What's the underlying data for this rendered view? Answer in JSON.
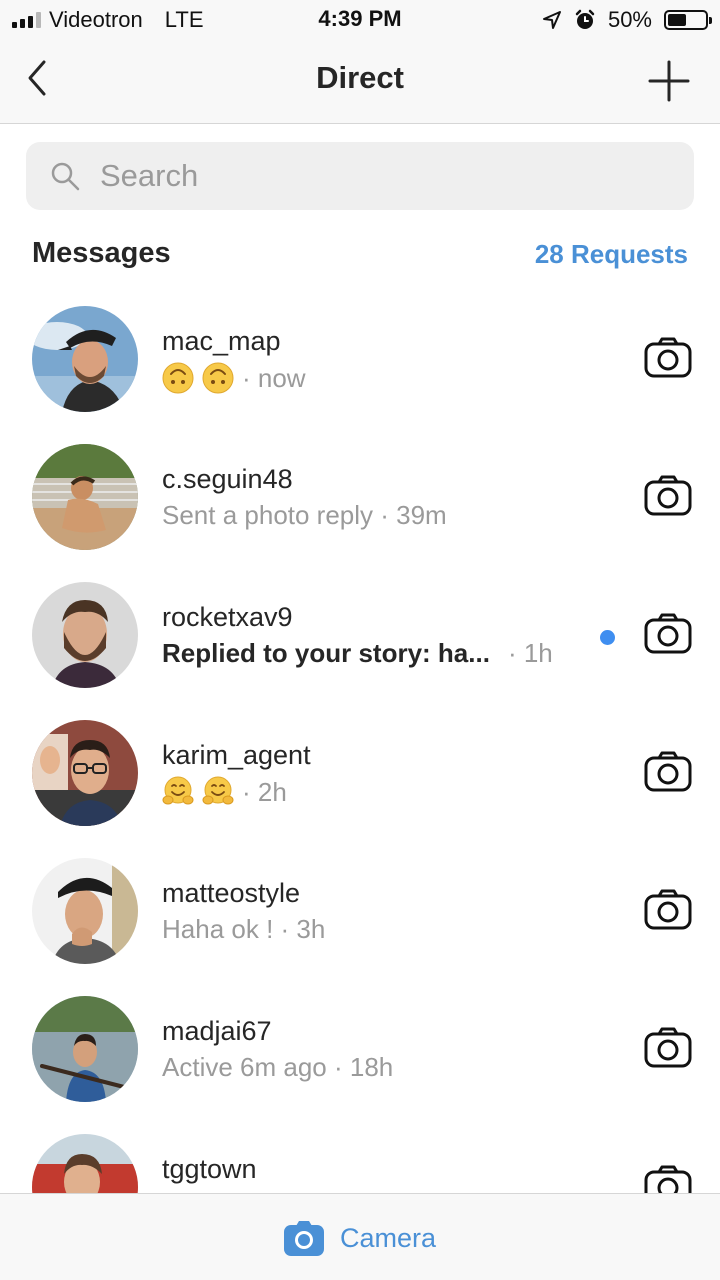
{
  "status_bar": {
    "carrier": "Videotron",
    "network": "LTE",
    "time": "4:39 PM",
    "battery": "50%",
    "battery_level": 0.5,
    "icons": [
      "signal-icon",
      "location-arrow-icon",
      "alarm-icon",
      "battery-icon"
    ]
  },
  "nav": {
    "title": "Direct",
    "back_icon": "chevron-left-icon",
    "add_icon": "plus-icon"
  },
  "search": {
    "placeholder": "Search",
    "icon": "search-icon"
  },
  "section": {
    "title": "Messages",
    "requests_label": "28 Requests"
  },
  "threads": [
    {
      "username": "mac_map",
      "emoji": [
        "upside-down-face",
        "upside-down-face"
      ],
      "time": "· now",
      "unread": false
    },
    {
      "username": "c.seguin48",
      "preview": "Sent a photo reply · 39m",
      "unread": false
    },
    {
      "username": "rocketxav9",
      "preview": "Replied to your story: ha...",
      "time": "· 1h",
      "unread": true
    },
    {
      "username": "karim_agent",
      "emoji": [
        "hugging-face",
        "hugging-face"
      ],
      "time": "· 2h",
      "unread": false
    },
    {
      "username": "matteostyle",
      "preview": "Haha ok ! · 3h",
      "unread": false
    },
    {
      "username": "madjai67",
      "preview": "Active 6m ago · 18h",
      "unread": false
    },
    {
      "username": "tggtown",
      "unread": false
    }
  ],
  "bottom_bar": {
    "camera_label": "Camera",
    "camera_icon": "camera-icon"
  },
  "colors": {
    "accent": "#4a90d6",
    "unread_dot": "#3f8ef0",
    "text_primary": "#262626",
    "text_secondary": "#9a9a9a",
    "bar_background": "#f8f8f8"
  }
}
